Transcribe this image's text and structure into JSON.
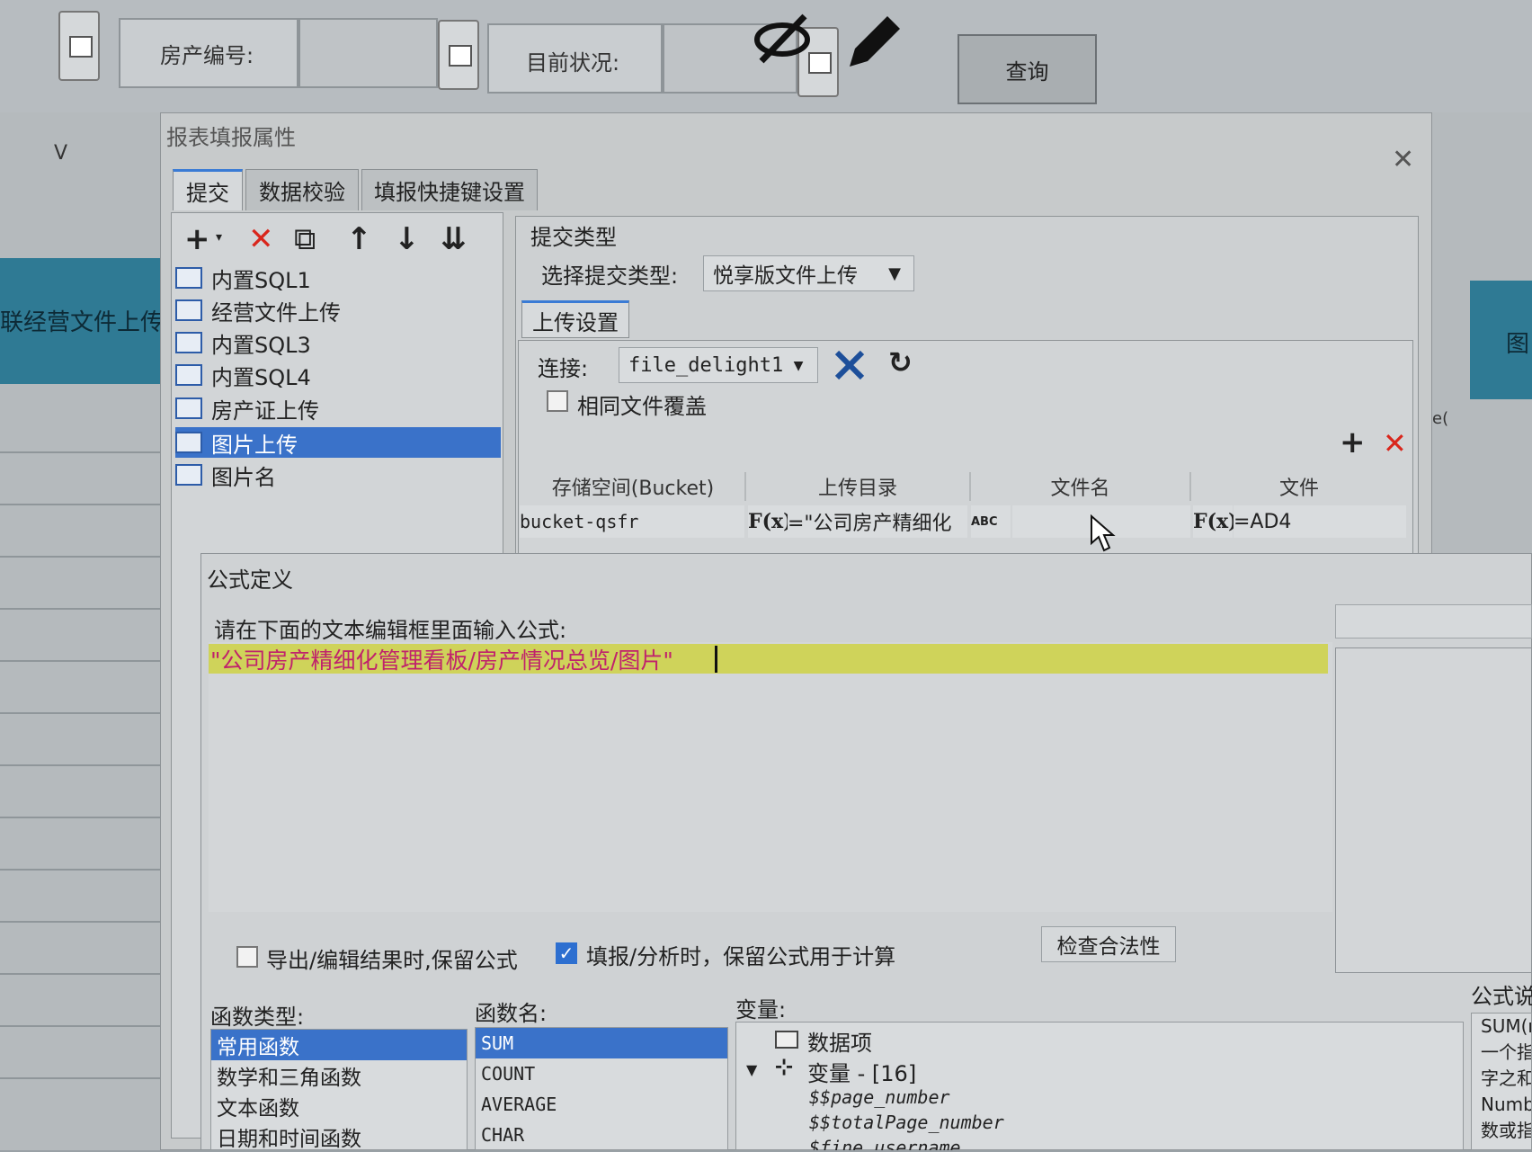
{
  "background_app": {
    "house_no_label": "房产编号:",
    "status_label": "目前状况:",
    "query_label": "查询",
    "col_header": "V",
    "left_teal_text": "联经营文件上传",
    "right_teal_text": "图",
    "right_fragment": "e("
  },
  "dialog": {
    "title": "报表填报属性",
    "close": "✕",
    "tabs": [
      "提交",
      "数据校验",
      "填报快捷键设置"
    ],
    "toolbar": {
      "add": "+",
      "add_arrow": "▾",
      "delete": "✕",
      "copy": "⧉",
      "up": "↑",
      "down": "↓",
      "sort": "⇊"
    },
    "submit_items": [
      "内置SQL1",
      "经营文件上传",
      "内置SQL3",
      "内置SQL4",
      "房产证上传",
      "图片上传",
      "图片名"
    ],
    "selected_index": 5,
    "submit_type_group": "提交类型",
    "submit_type_label": "选择提交类型:",
    "submit_type_value": "悦享版文件上传",
    "upload_tab": "上传设置",
    "connection_label": "连接:",
    "connection_value": "file_delight1",
    "overwrite_label": "相同文件覆盖",
    "table_add": "+",
    "table_delete": "✕",
    "table_headers": [
      "存储空间(Bucket)",
      "上传目录",
      "文件名",
      "文件"
    ],
    "row": {
      "bucket": "bucket-qsfr",
      "dir_fx": "F(x)",
      "dir_value": "=\"公司房产精细化",
      "name_icon": "ABC",
      "file_fx": "F(x)",
      "file_value": "=AD4"
    }
  },
  "formula": {
    "title": "公式定义",
    "prompt": "请在下面的文本编辑框里面输入公式:",
    "text": "\"公司房产精细化管理看板/房产情况总览/图片\"",
    "keep_formula_label": "导出/编辑结果时,保留公式",
    "keep_formula_checked": false,
    "keep_calc_label": "填报/分析时，保留公式用于计算",
    "keep_calc_checked": true,
    "check_button": "检查合法性",
    "func_type_label": "函数类型:",
    "func_types": [
      "常用函数",
      "数学和三角函数",
      "文本函数",
      "日期和时间函数"
    ],
    "func_name_label": "函数名:",
    "func_names": [
      "SUM",
      "COUNT",
      "AVERAGE",
      "CHAR"
    ],
    "var_label": "变量:",
    "var_tree": {
      "data_item": "数据项",
      "var_node": "变量 - [16]",
      "vars": [
        "$$page_number",
        "$$totalPage_number",
        "$fine_username"
      ]
    },
    "desc_label": "公式说",
    "desc_lines": [
      "SUM(n",
      "一个指",
      "字之和",
      "Numbe",
      "数或指"
    ]
  }
}
